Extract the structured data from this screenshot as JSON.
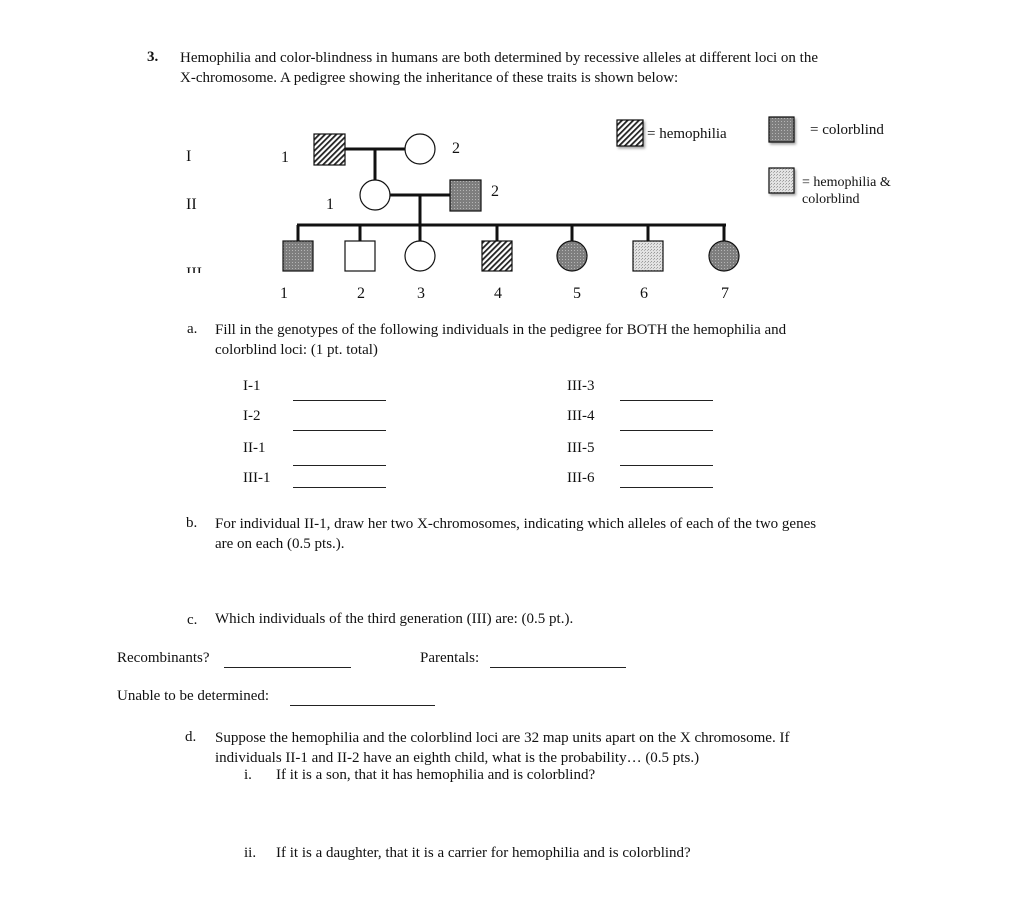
{
  "question": {
    "number": "3.",
    "intro_line1": "Hemophilia and color-blindness in humans are both determined by recessive alleles at different loci on the",
    "intro_line2": "X-chromosome.  A pedigree showing the inheritance of these traits is shown below:"
  },
  "legend": {
    "hemophilia": "= hemophilia",
    "colorblind": "= colorblind",
    "both_line1": "= hemophilia &",
    "both_line2": "colorblind"
  },
  "pedigree": {
    "generations": [
      "I",
      "II",
      "III"
    ],
    "gen1": [
      {
        "id": "I-1",
        "number": "1",
        "sex": "male",
        "phenotype": "hemophilia"
      },
      {
        "id": "I-2",
        "number": "2",
        "sex": "female",
        "phenotype": "unaffected"
      }
    ],
    "gen2": [
      {
        "id": "II-1",
        "number": "1",
        "sex": "female",
        "phenotype": "unaffected"
      },
      {
        "id": "II-2",
        "number": "2",
        "sex": "male",
        "phenotype": "colorblind"
      }
    ],
    "gen3": [
      {
        "id": "III-1",
        "number": "1",
        "sex": "male",
        "phenotype": "colorblind"
      },
      {
        "id": "III-2",
        "number": "2",
        "sex": "male",
        "phenotype": "unaffected"
      },
      {
        "id": "III-3",
        "number": "3",
        "sex": "female",
        "phenotype": "unaffected"
      },
      {
        "id": "III-4",
        "number": "4",
        "sex": "male",
        "phenotype": "hemophilia"
      },
      {
        "id": "III-5",
        "number": "5",
        "sex": "female",
        "phenotype": "colorblind"
      },
      {
        "id": "III-6",
        "number": "6",
        "sex": "male",
        "phenotype": "both"
      },
      {
        "id": "III-7",
        "number": "7",
        "sex": "female",
        "phenotype": "colorblind"
      }
    ]
  },
  "part_a": {
    "letter": "a.",
    "line1": "Fill in the genotypes of the following individuals in the pedigree for BOTH the hemophilia and",
    "line2": "colorblind loci:  (1 pt. total)",
    "left": [
      "I-1",
      "I-2",
      "II-1",
      "III-1"
    ],
    "right": [
      "III-3",
      "III-4",
      "III-5",
      "III-6"
    ]
  },
  "part_b": {
    "letter": "b.",
    "line1": "For individual II-1, draw her two X-chromosomes, indicating which alleles of each of the two genes",
    "line2": "are on each (0.5 pts.)."
  },
  "part_c": {
    "letter": "c.",
    "line1": "Which individuals of the third generation (III)  are: (0.5 pt.).",
    "recombinants": "Recombinants?",
    "parentals": "Parentals:",
    "undetermined": "Unable to be determined:"
  },
  "part_d": {
    "letter": "d.",
    "line1": "Suppose the hemophilia and the colorblind loci are 32 map units apart on the X chromosome.  If",
    "line2": "individuals II-1 and II-2 have an eighth child, what is the probability… (0.5 pts.)",
    "i_num": "i.",
    "i_text": "If it is a son, that it has hemophilia and is colorblind?",
    "ii_num": "ii.",
    "ii_text": "If it is a daughter, that it is a carrier for hemophilia and is colorblind?"
  },
  "colors": {
    "line": "#111111",
    "colorblind_fill": "#8c8c8c",
    "both_fill": "#d4d4d4",
    "hemophilia_stripe": "#222222"
  }
}
